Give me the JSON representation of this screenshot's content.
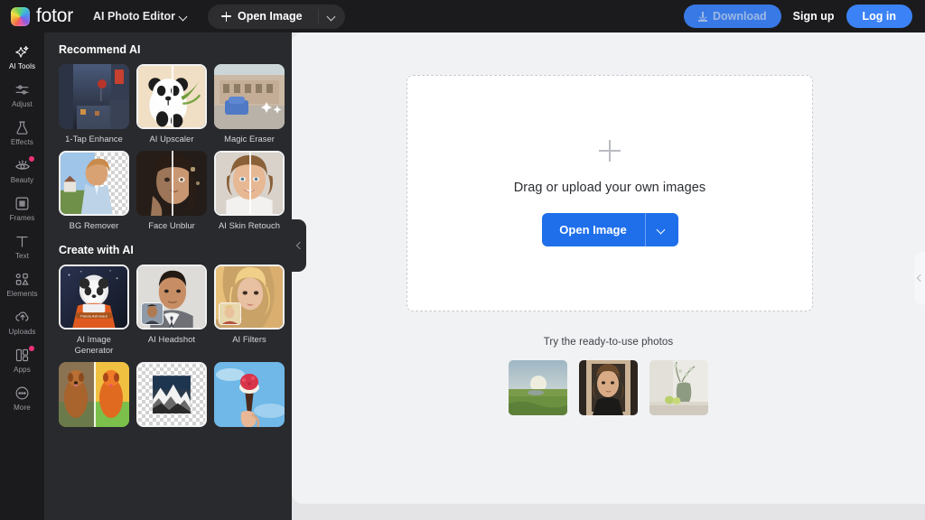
{
  "header": {
    "brand": "fotor",
    "app_switcher": "AI Photo Editor",
    "open_image": "Open Image",
    "download": "Download",
    "sign_up": "Sign up",
    "log_in": "Log in",
    "accent_color": "#3b82f6"
  },
  "sidebar": {
    "items": [
      {
        "label": "AI Tools",
        "icon": "sparkle-icon",
        "active": true,
        "badge": false
      },
      {
        "label": "Adjust",
        "icon": "sliders-icon",
        "active": false,
        "badge": false
      },
      {
        "label": "Effects",
        "icon": "flask-icon",
        "active": false,
        "badge": false
      },
      {
        "label": "Beauty",
        "icon": "eye-icon",
        "active": false,
        "badge": true
      },
      {
        "label": "Frames",
        "icon": "frame-icon",
        "active": false,
        "badge": false
      },
      {
        "label": "Text",
        "icon": "text-icon",
        "active": false,
        "badge": false
      },
      {
        "label": "Elements",
        "icon": "shapes-icon",
        "active": false,
        "badge": false
      },
      {
        "label": "Uploads",
        "icon": "upload-cloud-icon",
        "active": false,
        "badge": false
      },
      {
        "label": "Apps",
        "icon": "apps-grid-icon",
        "active": false,
        "badge": true
      },
      {
        "label": "More",
        "icon": "ellipsis-circle-icon",
        "active": false,
        "badge": false
      }
    ]
  },
  "panel": {
    "section_recommend": "Recommend AI",
    "section_create": "Create with AI",
    "recommend_tiles": [
      {
        "label": "1-Tap Enhance"
      },
      {
        "label": "AI Upscaler"
      },
      {
        "label": "Magic Eraser"
      },
      {
        "label": "BG Remover"
      },
      {
        "label": "Face Unblur"
      },
      {
        "label": "AI Skin Retouch"
      }
    ],
    "create_tiles": [
      {
        "label": "AI Image Generator"
      },
      {
        "label": "AI Headshot"
      },
      {
        "label": "AI Filters"
      },
      {
        "label": ""
      },
      {
        "label": ""
      },
      {
        "label": ""
      }
    ],
    "collapse_icon": "chevron-left-icon"
  },
  "canvas": {
    "dropzone_text": "Drag or upload your own images",
    "open_image_button": "Open Image",
    "plus_icon": "plus-icon",
    "dropdown_icon": "chevron-down-icon",
    "ready_title": "Try the ready-to-use photos",
    "ready_photos": [
      "field-landscape",
      "portrait-woman",
      "vase-still-life"
    ],
    "collapse_icon": "chevron-left-icon",
    "button_color": "#1f6feb"
  }
}
